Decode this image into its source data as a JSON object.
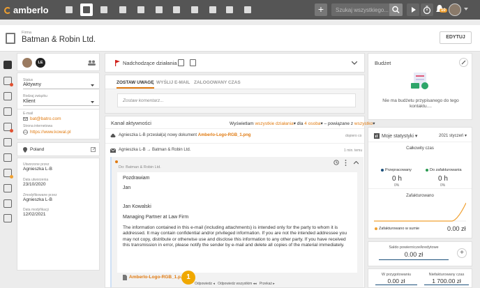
{
  "topbar": {
    "logo": "amberlo",
    "plus": "+",
    "search_placeholder": "Szukaj wszystkiego...",
    "notif_count": "10"
  },
  "header": {
    "firm_label": "Firma",
    "firm_name": "Batman & Robin Ltd.",
    "edit_label": "EDYTUJ"
  },
  "left": {
    "avatar_initials": "LE",
    "status_label": "Status",
    "status_value": "Aktywny",
    "relation_label": "Rodzaj związku",
    "relation_value": "Klient",
    "email_label": "E-mail",
    "email_value": "bat@batro.com",
    "website_label": "Strona internetowa",
    "website_value": "https://www.kowal.pl",
    "country": "Poland",
    "created_by_label": "Utworzone przez",
    "created_by_value": "Agnieszka L-B",
    "created_date_label": "Data utworzenia",
    "created_date_value": "23/10/2020",
    "modified_by_label": "Zmodyfikowane przez",
    "modified_by_value": "Agnieszka L-B",
    "modified_date_label": "Data modyfikacji",
    "modified_date_value": "12/02/2021"
  },
  "mid": {
    "next_actions": "Nadchodzące działania",
    "tabs": [
      "ZOSTAW UWAGĘ",
      "WYŚLIJ E-MAIL",
      "ZALOGOWANY CZAS"
    ],
    "comment_placeholder": "Zostaw komentarz...",
    "feed_title": "Kanał aktywności",
    "filter_show": "Wyświetlam",
    "filter_all": "wszystkie działania",
    "filter_for": "dla",
    "filter_persons": "4 osoba",
    "filter_related": "powiązane z",
    "filter_everything": "wszystko",
    "item1_text": "Agnieszka L-B przesłał(a) nowy dokument",
    "item1_doc": "Amberlo-Logo-RGB_1.png",
    "item1_time": "dopiero co",
    "item2_text": "Agnieszka L-B → Batman & Robin Ltd.",
    "item2_time": "1 min. temu",
    "email_to": "Do: Batman & Robin Ltd.",
    "email_lines": [
      "Pozdrawiam",
      "Jan",
      "Jan Kowalski",
      "Managing Partner at Law Firm"
    ],
    "email_disclaimer": "The information contained in this e-mail (including attachments) is intended only for the party to whom it is addressed. It may contain confidential and/or privileged information. If you are not the intended addressee you may not copy, distribute or otherwise use and disclose this information to any other party. If you have received this transmission in error, please notify the sender by e-mail and delete all copies of the material immediately.",
    "attachment": "Amberlo-Logo-RGB_1.p...",
    "callout_number": "1",
    "reply": "Odpowiedz",
    "reply_all": "Odpowiedz wszystkim",
    "forward": "Przekaż"
  },
  "right": {
    "budget_title": "Budżet",
    "budget_empty": "Nie ma budżetu przypisanego do tego kontaktu....",
    "stats_title": "Moje statystyki",
    "stats_period": "2021 styczeń",
    "total_time": "Całkowity czas",
    "worked_label": "Przepracowany",
    "worked_value": "0 h",
    "worked_pct": "0%",
    "to_bill_label": "Do zafakturowania",
    "to_bill_value": "0 h",
    "to_bill_pct": "0%",
    "billed_title": "Zafakturowano",
    "billed_total_label": "Zafakturowano w sumie",
    "billed_total_value": "0.00 zł",
    "balance_label": "Saldo powiernicze/kredytowe",
    "balance_value": "0.00 zł",
    "wip_label": "W przygotowaniu",
    "wip_value": "0.00 zł",
    "unbilled_label": "Niefakturowany czas",
    "unbilled_value": "1 700.00 zł"
  },
  "colors": {
    "accent": "#e07a10",
    "topbar": "#555555",
    "flag": "#d0201a",
    "dot_blue": "#1a4f7a",
    "dot_green": "#2a9a50"
  }
}
